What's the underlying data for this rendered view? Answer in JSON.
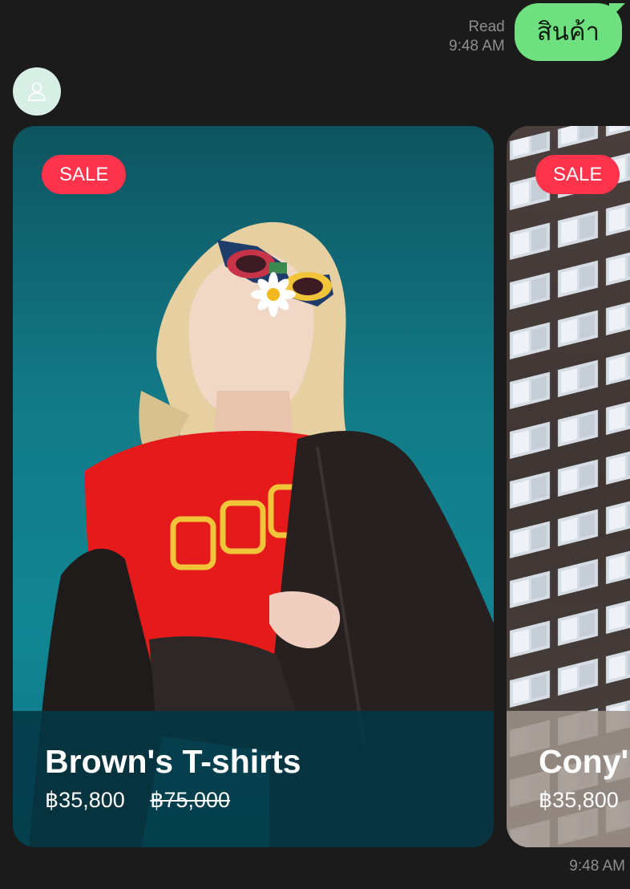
{
  "sent_message": {
    "text": "สินค้า",
    "read_label": "Read",
    "time": "9:48 AM"
  },
  "received": {
    "avatar_icon": "user-icon",
    "time": "9:48 AM"
  },
  "cards": [
    {
      "badge": "SALE",
      "title": "Brown's T-shirts",
      "price": "฿35,800",
      "old_price": "฿75,000"
    },
    {
      "badge": "SALE",
      "title": "Cony's",
      "price": "฿35,800"
    }
  ],
  "colors": {
    "background": "#1b1b1b",
    "bubble": "#6ee07f",
    "sale_badge": "#ff334b"
  }
}
